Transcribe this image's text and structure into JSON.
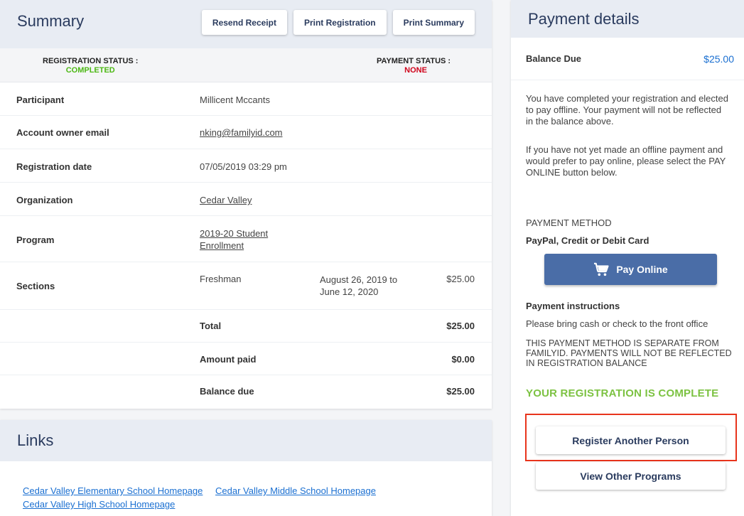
{
  "summary": {
    "title": "Summary",
    "buttons": {
      "resend": "Resend Receipt",
      "print_registration": "Print Registration",
      "print_summary": "Print Summary"
    },
    "registration_status": {
      "label": "REGISTRATION STATUS :",
      "value": "COMPLETED"
    },
    "payment_status": {
      "label": "PAYMENT STATUS :",
      "value": "NONE"
    },
    "rows": {
      "participant": {
        "label": "Participant",
        "value": "Millicent Mccants"
      },
      "email": {
        "label": "Account owner email",
        "value": "nking@familyid.com"
      },
      "reg_date": {
        "label": "Registration date",
        "value": "07/05/2019 03:29 pm"
      },
      "organization": {
        "label": "Organization",
        "value": "Cedar Valley"
      },
      "program": {
        "label": "Program",
        "value_line1": "2019-20 Student",
        "value_line2": "Enrollment"
      },
      "sections": {
        "label": "Sections",
        "name": "Freshman",
        "dates_line1": "August 26, 2019 to",
        "dates_line2": "June 12, 2020",
        "amount": "$25.00"
      },
      "total": {
        "label": "Total",
        "amount": "$25.00"
      },
      "amount_paid": {
        "label": "Amount paid",
        "amount": "$0.00"
      },
      "balance_due": {
        "label": "Balance due",
        "amount": "$25.00"
      }
    }
  },
  "links": {
    "title": "Links",
    "items": [
      "Cedar Valley Elementary School Homepage",
      "Cedar Valley Middle School Homepage",
      "Cedar Valley High School Homepage"
    ]
  },
  "payment": {
    "title": "Payment details",
    "balance_label": "Balance Due",
    "balance_amount": "$25.00",
    "message1": "You have completed your registration and elected to pay offline. Your payment will not be reflected in the balance above.",
    "message2": "If you have not yet made an offline payment and would prefer to pay online, please select the PAY ONLINE button below.",
    "method_heading": "PAYMENT METHOD",
    "method_value": "PayPal, Credit or Debit Card",
    "pay_online": "Pay Online",
    "instructions_heading": "Payment instructions",
    "instructions_text": "Please bring cash or check to the front office",
    "separate_notice": "THIS PAYMENT METHOD IS SEPARATE FROM FAMILYID. PAYMENTS WILL NOT BE REFLECTED IN REGISTRATION BALANCE",
    "complete_text": "YOUR REGISTRATION IS COMPLETE",
    "register_another": "Register Another Person",
    "view_programs": "View Other Programs"
  },
  "colors": {
    "accent": "#4a6da7",
    "link": "#1a6fd1",
    "success": "#7cc242",
    "status_green": "#4cb814",
    "status_red": "#d0021b",
    "highlight": "#e8341c"
  },
  "icons": {
    "cart": "cart-icon"
  }
}
